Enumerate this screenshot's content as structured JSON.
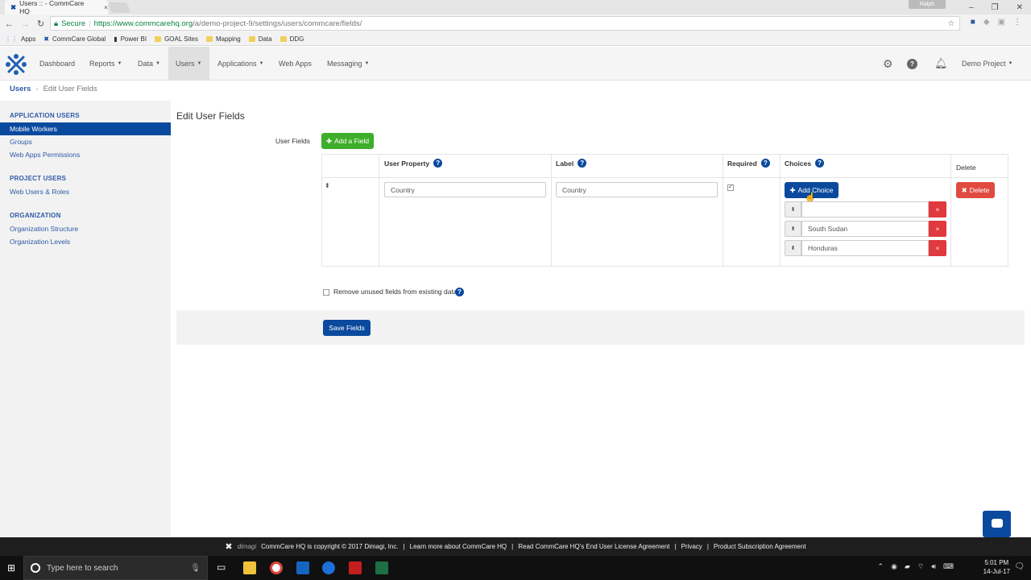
{
  "browser": {
    "tab_title": "Users :: - CommCare HQ",
    "tab_close": "×",
    "profile": "Ralph",
    "secure_label": "Secure",
    "url_host": "https://www.commcarehq.org",
    "url_path": "/a/demo-project-9/settings/users/commcare/fields/",
    "bookmarks": [
      "Apps",
      "CommCare Global",
      "Power BI",
      "GOAL Sites",
      "Mapping",
      "Data",
      "DDG"
    ]
  },
  "nav": {
    "items": [
      "Dashboard",
      "Reports",
      "Data",
      "Users",
      "Applications",
      "Web Apps",
      "Messaging"
    ],
    "project": "Demo Project"
  },
  "breadcrumb": {
    "root": "Users",
    "current": "Edit User Fields"
  },
  "sidebar": {
    "section1": "APPLICATION USERS",
    "section1_items": [
      "Mobile Workers",
      "Groups",
      "Web Apps Permissions"
    ],
    "section2": "PROJECT USERS",
    "section2_items": [
      "Web Users & Roles"
    ],
    "section3": "ORGANIZATION",
    "section3_items": [
      "Organization Structure",
      "Organization Levels"
    ]
  },
  "main": {
    "title": "Edit User Fields",
    "user_fields_label": "User Fields",
    "add_field_button": "Add a Field",
    "columns": {
      "user_property": "User Property",
      "label": "Label",
      "required": "Required",
      "choices": "Choices",
      "delete": "Delete"
    },
    "row": {
      "user_property": "Country",
      "label": "Country",
      "required": true,
      "add_choice_button": "Add Choice",
      "choices": [
        "",
        "South Sudan",
        "Honduras"
      ],
      "delete_button": "Delete"
    },
    "remove_unused_label": "Remove unused fields from existing data.",
    "save_button": "Save Fields"
  },
  "footer": {
    "brand": "dimagi",
    "text": "CommCare HQ is copyright © 2017 Dimagi, Inc.",
    "links": [
      "Learn more about CommCare HQ",
      "Read CommCare HQ's End User License Agreement",
      "Privacy",
      "Product Subscription Agreement"
    ]
  },
  "taskbar": {
    "search_placeholder": "Type here to search",
    "time": "5:01 PM",
    "date": "14-Jul-17"
  },
  "colors": {
    "primary": "#0a4a9e",
    "success": "#3fae2a",
    "danger": "#e04a3f"
  }
}
